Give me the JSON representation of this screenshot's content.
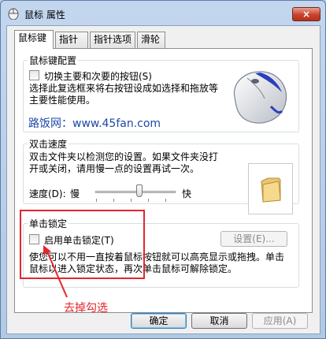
{
  "window": {
    "title": "鼠标 属性",
    "close_label": "×"
  },
  "tabs": [
    {
      "label": "鼠标键"
    },
    {
      "label": "指针"
    },
    {
      "label": "指针选项"
    },
    {
      "label": "滑轮"
    }
  ],
  "button_config": {
    "title": "鼠标键配置",
    "switch_label": "切换主要和次要的按钮(S)",
    "switch_checked": false,
    "description": "选择此复选框来将右按钮设成如选择和拖放等主要性能使用。"
  },
  "watermark": "路饭网：www.45fan.com",
  "double_click": {
    "title": "双击速度",
    "description": "双击文件夹以检测您的设置。如果文件夹没打开或关闭，请用慢一点的设置再试一次。",
    "speed_label": "速度(D):",
    "slow_label": "慢",
    "fast_label": "快",
    "speed_level": 0.55
  },
  "click_lock": {
    "title": "单击锁定",
    "enable_label": "启用单击锁定(T)",
    "enable_checked": false,
    "settings_label": "设置(E)...",
    "description": "使您可以不用一直按着鼠标按钮就可以高亮显示或拖拽。单击鼠标以进入锁定状态，再次单击鼠标可解除锁定。"
  },
  "footer": {
    "ok_label": "确定",
    "cancel_label": "取消",
    "apply_label": "应用(A)"
  },
  "annotation": {
    "text": "去掉勾选",
    "color": "#e4262d"
  }
}
